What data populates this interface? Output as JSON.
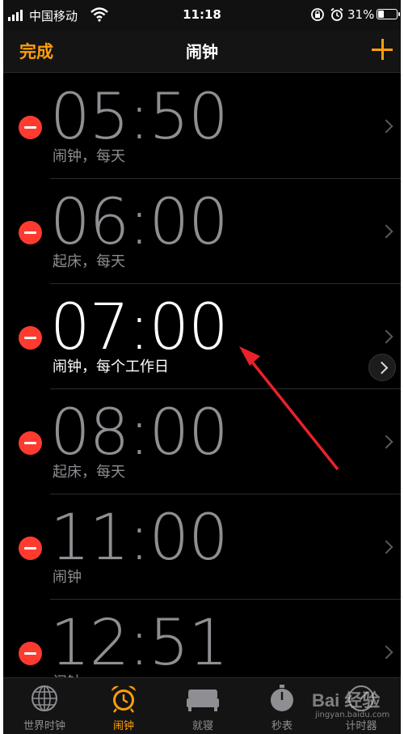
{
  "status_bar": {
    "carrier": "中国移动",
    "time": "11:18",
    "battery_percent": "31%",
    "battery_level": 0.31
  },
  "nav": {
    "done_label": "完成",
    "title": "闹钟",
    "add_icon": "plus-icon"
  },
  "alarms": [
    {
      "time": "05:50",
      "label": "闹钟，每天",
      "enabled": false
    },
    {
      "time": "06:00",
      "label": "起床，每天",
      "enabled": false
    },
    {
      "time": "07:00",
      "label": "闹钟，每个工作日",
      "enabled": true
    },
    {
      "time": "08:00",
      "label": "起床，每天",
      "enabled": false
    },
    {
      "time": "11:00",
      "label": "闹钟",
      "enabled": false
    },
    {
      "time": "12:51",
      "label": "闹钟",
      "enabled": false
    }
  ],
  "tabs": [
    {
      "label": "世界时钟",
      "icon": "globe-icon",
      "active": false
    },
    {
      "label": "闹钟",
      "icon": "alarm-clock-icon",
      "active": true
    },
    {
      "label": "就寝",
      "icon": "bed-icon",
      "active": false
    },
    {
      "label": "秒表",
      "icon": "stopwatch-icon",
      "active": false
    },
    {
      "label": "计时器",
      "icon": "timer-icon",
      "active": false
    }
  ],
  "colors": {
    "accent": "#ff9f0a",
    "delete": "#ff3b30",
    "annotation_arrow": "#e8222a"
  },
  "watermark": {
    "brand": "Bai 经验",
    "url": "jingyan.baidu.com"
  }
}
